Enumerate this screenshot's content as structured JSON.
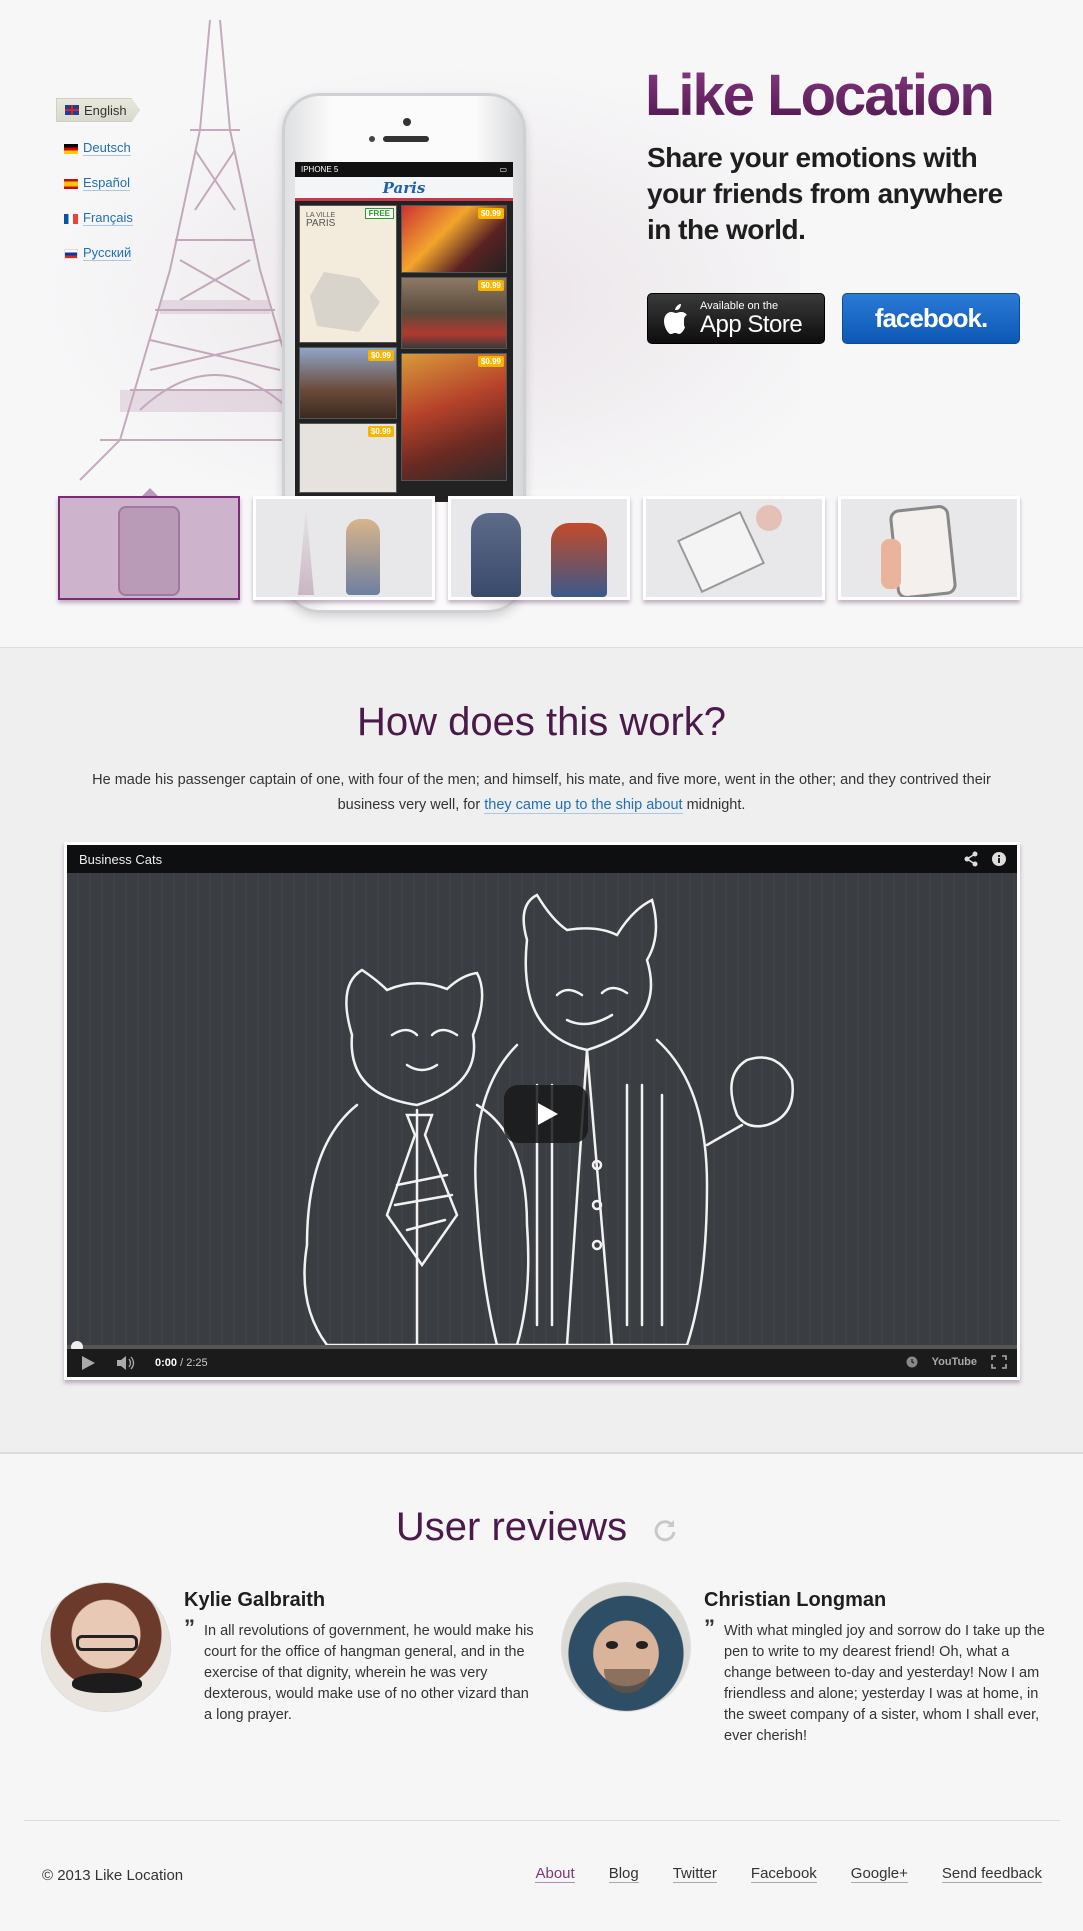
{
  "languages": [
    {
      "label": "English",
      "flag_colors": [
        "#1f3f8f",
        "#d22",
        "#fff"
      ],
      "active": true
    },
    {
      "label": "Deutsch",
      "flag_colors": [
        "#000",
        "#d00",
        "#fc0"
      ]
    },
    {
      "label": "Español",
      "flag_colors": [
        "#c60b1e",
        "#ffc400",
        "#c60b1e"
      ]
    },
    {
      "label": "Français",
      "flag_colors": [
        "#0055a4",
        "#fff",
        "#ef4135"
      ]
    },
    {
      "label": "Русский",
      "flag_colors": [
        "#fff",
        "#0039a6",
        "#d52b1e"
      ]
    }
  ],
  "phone": {
    "carrier": "IPHONE 5",
    "app_title": "Paris",
    "map_card": {
      "line1": "LA VILLE",
      "line2": "PARIS"
    },
    "badges": {
      "free": "FREE",
      "price": "$0.99"
    }
  },
  "hero": {
    "brand": "Like Location",
    "tagline": "Share your emotions with your friends from anywhere in the world.",
    "appstore": {
      "small": "Available on the",
      "big": "App Store"
    },
    "facebook_label": "facebook."
  },
  "how": {
    "title": "How does this work?",
    "text_before": "He made his passenger captain of one, with four of the men; and himself, his mate, and five more, went in the other; and they contrived their business very well, for ",
    "link": "they came up to the ship about",
    "text_after": " midnight.",
    "video": {
      "title": "Business Cats",
      "time_current": "0:00",
      "time_total": " / 2:25",
      "youtube_label": "YouTube"
    }
  },
  "reviews": {
    "title": "User reviews",
    "items": [
      {
        "name": "Kylie Galbraith",
        "text": "In all revolutions of government, he would make his court for the office of hangman general, and in the exercise of that dignity, wherein he was very dexterous, would make use of no other vizard than a long prayer."
      },
      {
        "name": "Christian Longman",
        "text": "With what mingled joy and sorrow do I take up the pen to write to my dearest friend! Oh, what a change between to-day and yesterday! Now I am friendless and alone; yesterday I was at home, in the sweet company of a sister, whom I shall ever, ever cherish!"
      }
    ]
  },
  "footer": {
    "copyright": "© 2013 Like Location",
    "links": [
      "About",
      "Blog",
      "Twitter",
      "Facebook",
      "Google+",
      "Send feedback"
    ],
    "current": "About"
  },
  "colors": {
    "brand_purple": "#5a1e55",
    "link_blue": "#1f6fb8",
    "facebook_blue": "#1565c0"
  }
}
